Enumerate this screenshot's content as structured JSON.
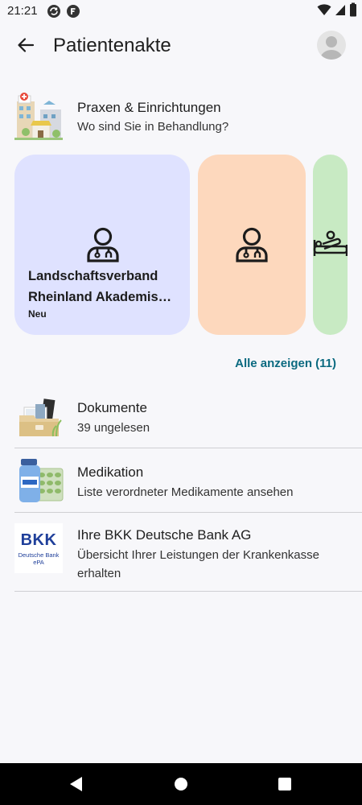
{
  "status_bar": {
    "time": "21:21",
    "icons": [
      "sync-icon",
      "app-f-icon",
      "wifi-icon",
      "signal-icon",
      "battery-icon"
    ]
  },
  "app_bar": {
    "back_icon": "arrow-back-icon",
    "title": "Patientenakte",
    "avatar_icon": "person-avatar-icon"
  },
  "facilities": {
    "title": "Praxen & Einrichtungen",
    "subtitle": "Wo sind Sie in Behandlung?",
    "illustration": "buildings-illustration",
    "cards": [
      {
        "name_line1": "Landschaftsverband",
        "name_line2": "Rheinland Akademis…",
        "badge": "Neu",
        "icon": "doctor-icon",
        "color": "#dfe2ff"
      },
      {
        "icon": "doctor-icon",
        "color": "#fdd8bd"
      },
      {
        "icon": "hospital-bed-icon",
        "color": "#c8eac3"
      }
    ],
    "show_all": "Alle anzeigen (11)"
  },
  "items": [
    {
      "title": "Dokumente",
      "subtitle": "39 ungelesen",
      "illustration": "documents-folder-illustration"
    },
    {
      "title": "Medikation",
      "subtitle": "Liste verordneter Medikamente ansehen",
      "illustration": "medication-illustration"
    },
    {
      "title": "Ihre BKK Deutsche Bank AG",
      "subtitle": "Übersicht Ihrer Leistungen der Krankenkasse erhalten",
      "logo": {
        "name": "BKK",
        "line1": "Deutsche Bank",
        "line2": "ePA"
      }
    }
  ],
  "colors": {
    "accent_link": "#0b6a80",
    "bkk_blue": "#1f3f9a",
    "background": "#f7f7fa"
  },
  "nav_bar": {
    "back": "nav-back-icon",
    "home": "nav-home-icon",
    "recents": "nav-recents-icon"
  }
}
